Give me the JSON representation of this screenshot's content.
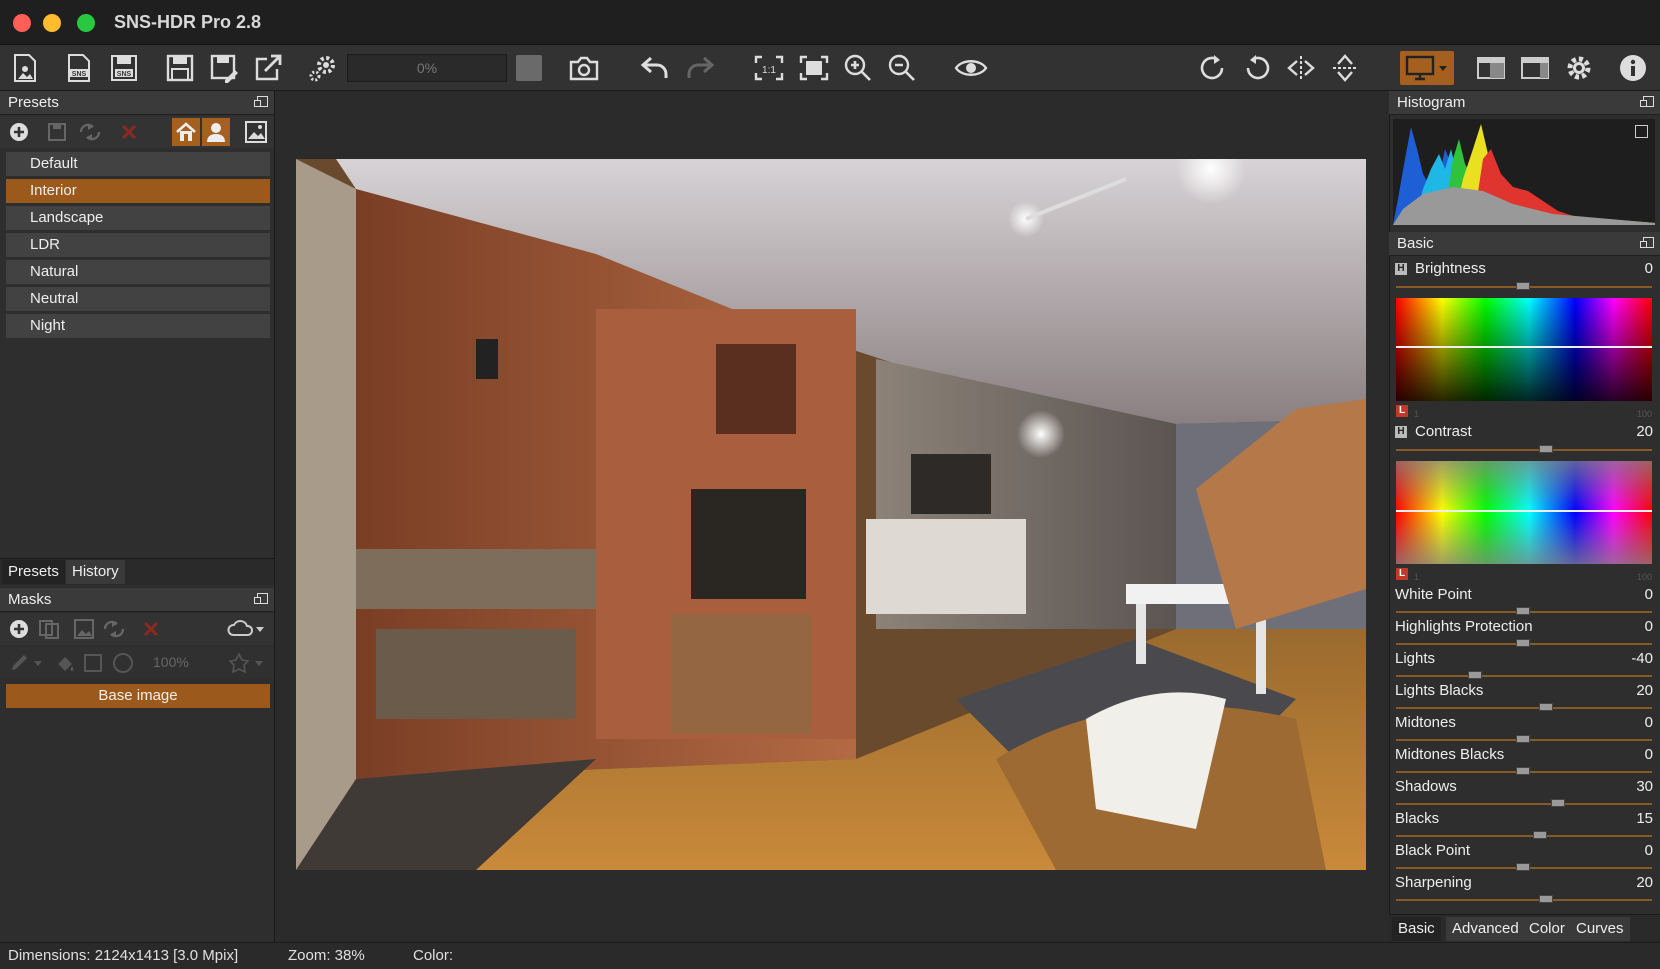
{
  "window": {
    "title": "SNS-HDR Pro 2.8"
  },
  "toolbar": {
    "progress": "0%"
  },
  "presets_panel": {
    "title": "Presets",
    "items": [
      {
        "label": "Default",
        "selected": false
      },
      {
        "label": "Interior",
        "selected": true
      },
      {
        "label": "Landscape",
        "selected": false
      },
      {
        "label": "LDR",
        "selected": false
      },
      {
        "label": "Natural",
        "selected": false
      },
      {
        "label": "Neutral",
        "selected": false
      },
      {
        "label": "Night",
        "selected": false
      }
    ],
    "tabs": [
      "Presets",
      "History"
    ]
  },
  "masks_panel": {
    "title": "Masks",
    "opacity": "100%",
    "base_image": "Base image"
  },
  "histogram_panel": {
    "title": "Histogram"
  },
  "basic_panel": {
    "title": "Basic",
    "brightness": {
      "label": "Brightness",
      "value": "0"
    },
    "contrast": {
      "label": "Contrast",
      "value": "20"
    },
    "h_marker": "H",
    "l_marker": "L",
    "range_min": "1",
    "range_max": "100",
    "sliders": [
      {
        "label": "White Point",
        "value": "0"
      },
      {
        "label": "Highlights Protection",
        "value": "0"
      },
      {
        "label": "Lights",
        "value": "-40"
      },
      {
        "label": "Lights Blacks",
        "value": "20"
      },
      {
        "label": "Midtones",
        "value": "0"
      },
      {
        "label": "Midtones Blacks",
        "value": "0"
      },
      {
        "label": "Shadows",
        "value": "30"
      },
      {
        "label": "Blacks",
        "value": "15"
      },
      {
        "label": "Black Point",
        "value": "0"
      },
      {
        "label": "Sharpening",
        "value": "20"
      }
    ],
    "tabs": [
      "Basic",
      "Advanced",
      "Color",
      "Curves"
    ]
  },
  "statusbar": {
    "dimensions": "Dimensions: 2124x1413 [3.0 Mpix]",
    "zoom": "Zoom: 38%",
    "color": "Color:"
  },
  "colors": {
    "accent": "#9b5a1c",
    "slider_track": "#8a5a26"
  },
  "icons": [
    "new-image-icon",
    "sns-open-icon",
    "sns-save-icon",
    "save-icon",
    "save-as-icon",
    "export-icon",
    "process-gear-icon",
    "camera-icon",
    "undo-icon",
    "redo-icon",
    "zoom-1to1-icon",
    "fit-icon",
    "zoom-in-icon",
    "zoom-out-icon",
    "eye-icon",
    "rotate-cw-icon",
    "rotate-ccw-icon",
    "flip-horizontal-icon",
    "flip-vertical-icon",
    "monitor-icon",
    "layout-1-icon",
    "layout-2-icon",
    "settings-gear-icon",
    "info-icon"
  ]
}
